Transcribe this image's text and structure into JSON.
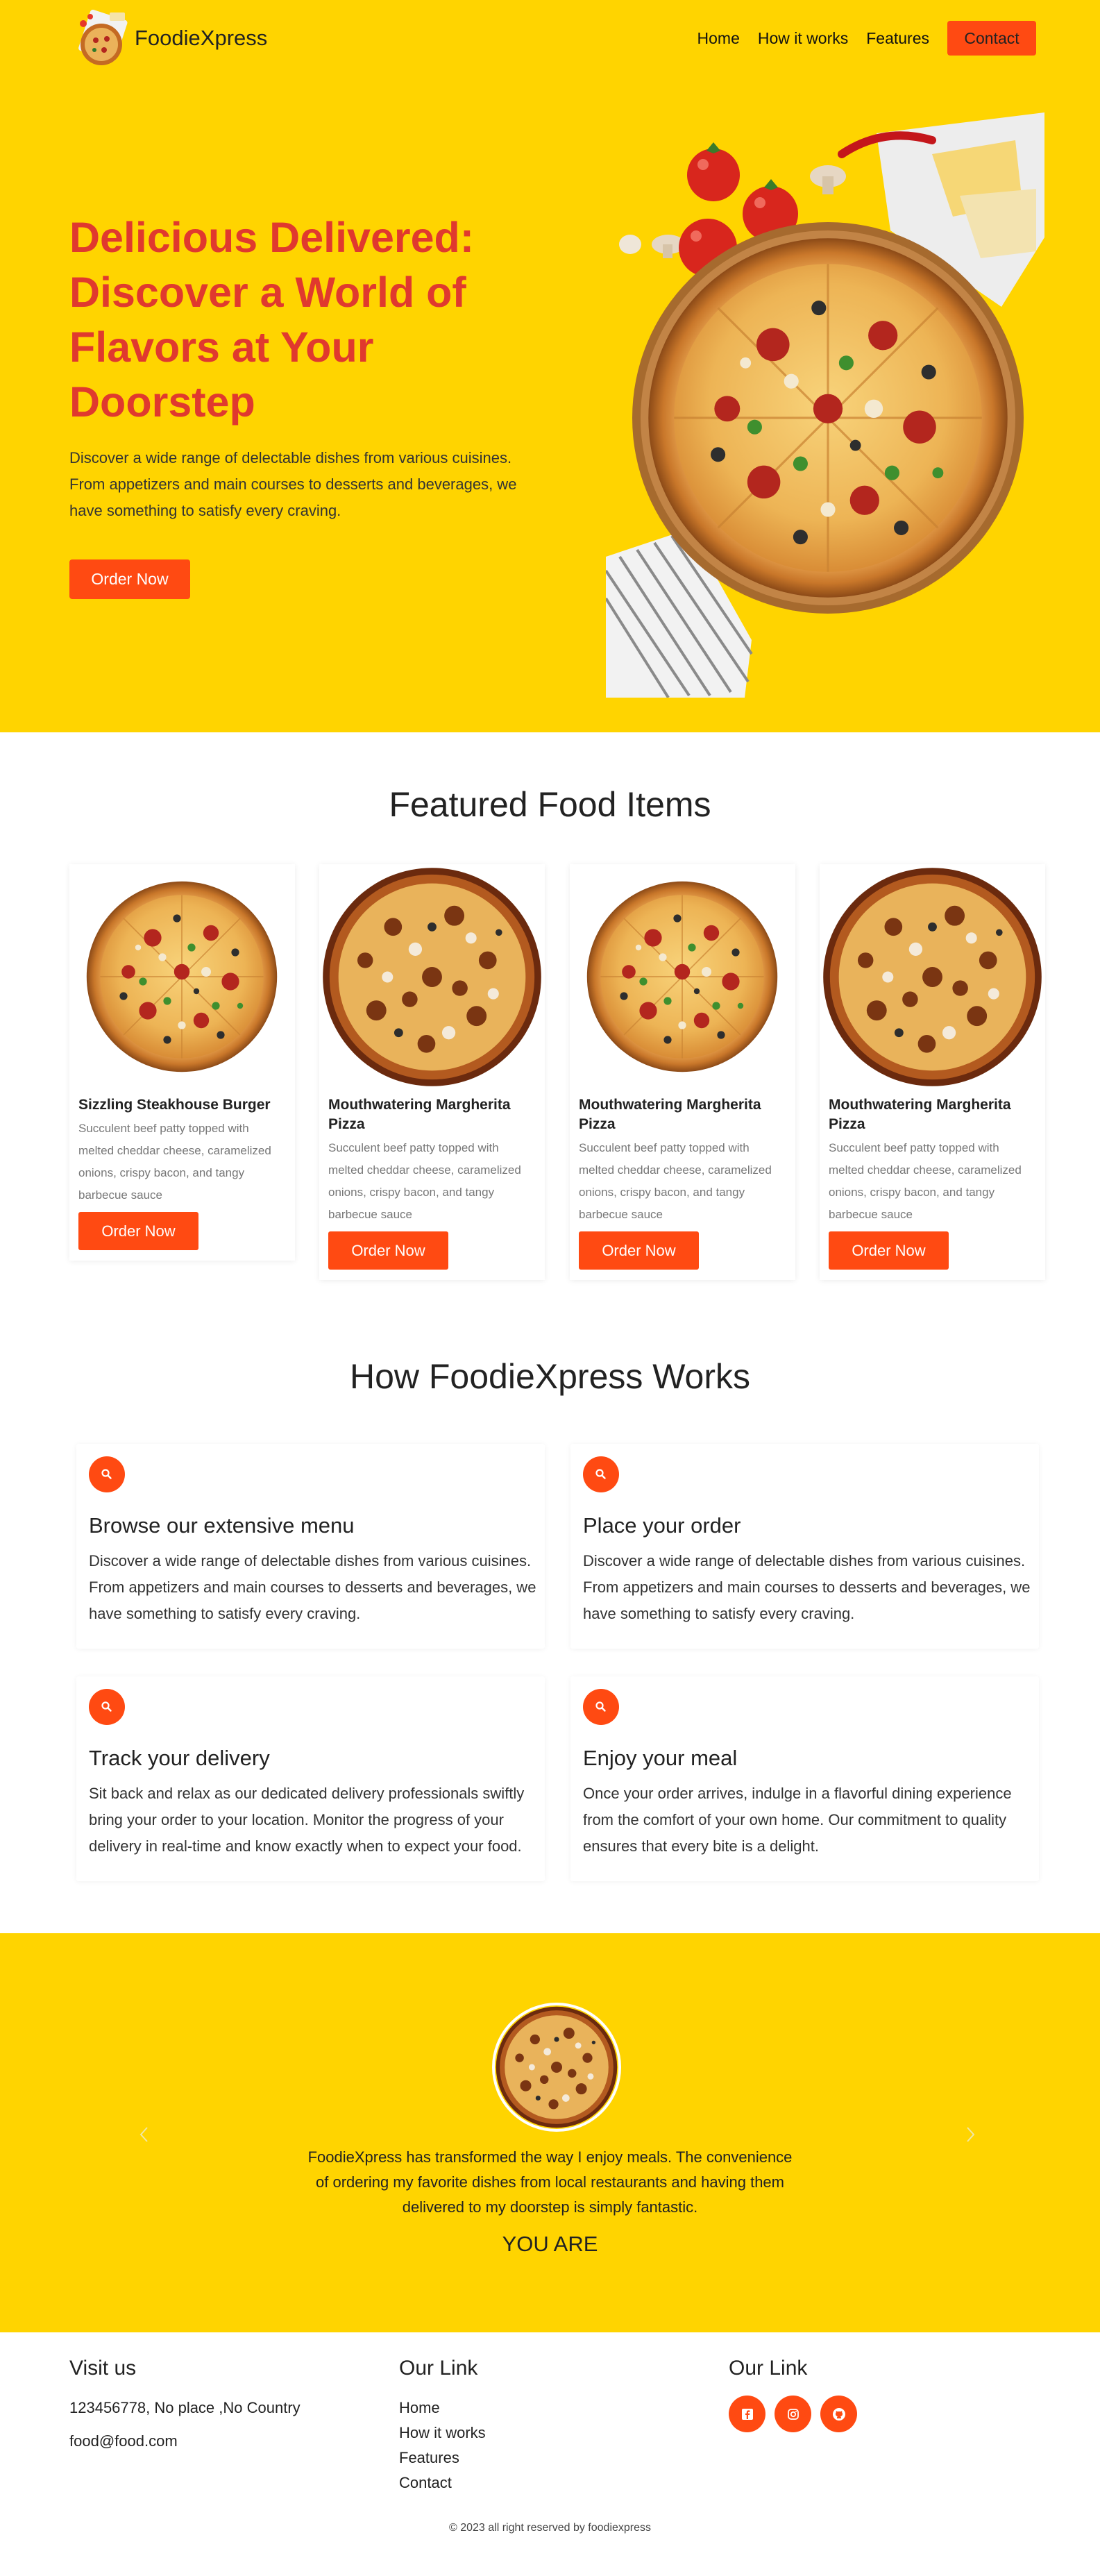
{
  "header": {
    "brand": "FoodieXpress",
    "nav": [
      "Home",
      "How it works",
      "Features"
    ],
    "contact_label": "Contact"
  },
  "hero": {
    "title": "Delicious Delivered: Discover a World of Flavors at Your Doorstep",
    "description": "Discover a wide range of delectable dishes from various cuisines. From appetizers and main courses to desserts and beverages, we have something to satisfy every craving.",
    "cta": "Order Now",
    "image_icon": "pizza-with-ingredients-image"
  },
  "featured": {
    "title": "Featured Food Items",
    "items": [
      {
        "name": "Sizzling Steakhouse Burger",
        "desc": "Succulent beef patty topped with melted cheddar cheese, caramelized onions, crispy bacon, and tangy barbecue sauce",
        "cta": "Order Now"
      },
      {
        "name": "Mouthwatering Margherita Pizza",
        "desc": "Succulent beef patty topped with melted cheddar cheese, caramelized onions, crispy bacon, and tangy barbecue sauce",
        "cta": "Order Now"
      },
      {
        "name": "Mouthwatering Margherita Pizza",
        "desc": "Succulent beef patty topped with melted cheddar cheese, caramelized onions, crispy bacon, and tangy barbecue sauce",
        "cta": "Order Now"
      },
      {
        "name": "Mouthwatering Margherita Pizza",
        "desc": "Succulent beef patty topped with melted cheddar cheese, caramelized onions, crispy bacon, and tangy barbecue sauce",
        "cta": "Order Now"
      }
    ]
  },
  "how": {
    "title": "How FoodieXpress Works",
    "steps": [
      {
        "icon": "search-icon",
        "title": "Browse our extensive menu",
        "desc": "Discover a wide range of delectable dishes from various cuisines. From appetizers and main courses to desserts and beverages, we have something to satisfy every craving."
      },
      {
        "icon": "search-icon",
        "title": "Place your order",
        "desc": "Discover a wide range of delectable dishes from various cuisines. From appetizers and main courses to desserts and beverages, we have something to satisfy every craving."
      },
      {
        "icon": "search-icon",
        "title": "Track your delivery",
        "desc": "Sit back and relax as our dedicated delivery professionals swiftly bring your order to your location. Monitor the progress of your delivery in real-time and know exactly when to expect your food."
      },
      {
        "icon": "search-icon",
        "title": "Enjoy your meal",
        "desc": "Once your order arrives, indulge in a flavorful dining experience from the comfort of your own home. Our commitment to quality ensures that every bite is a delight."
      }
    ]
  },
  "testimonial": {
    "text": "FoodieXpress has transformed the way I enjoy meals. The convenience of ordering my favorite dishes from local restaurants and having them delivered to my doorstep is simply fantastic.",
    "author": "YOU ARE"
  },
  "footer": {
    "visit_title": "Visit us",
    "address": "123456778, No place ,No Country",
    "email": "food@food.com",
    "links_title": "Our Link",
    "links": [
      "Home",
      "How it works",
      "Features",
      "Contact"
    ],
    "social_title": "Our Link",
    "socials": [
      "facebook-icon",
      "instagram-icon",
      "github-icon"
    ],
    "copyright": "© 2023 all right reserved by foodiexpress"
  },
  "colors": {
    "yellow": "#FFD400",
    "accent": "#FF4A12",
    "title_red": "#E0392E"
  }
}
